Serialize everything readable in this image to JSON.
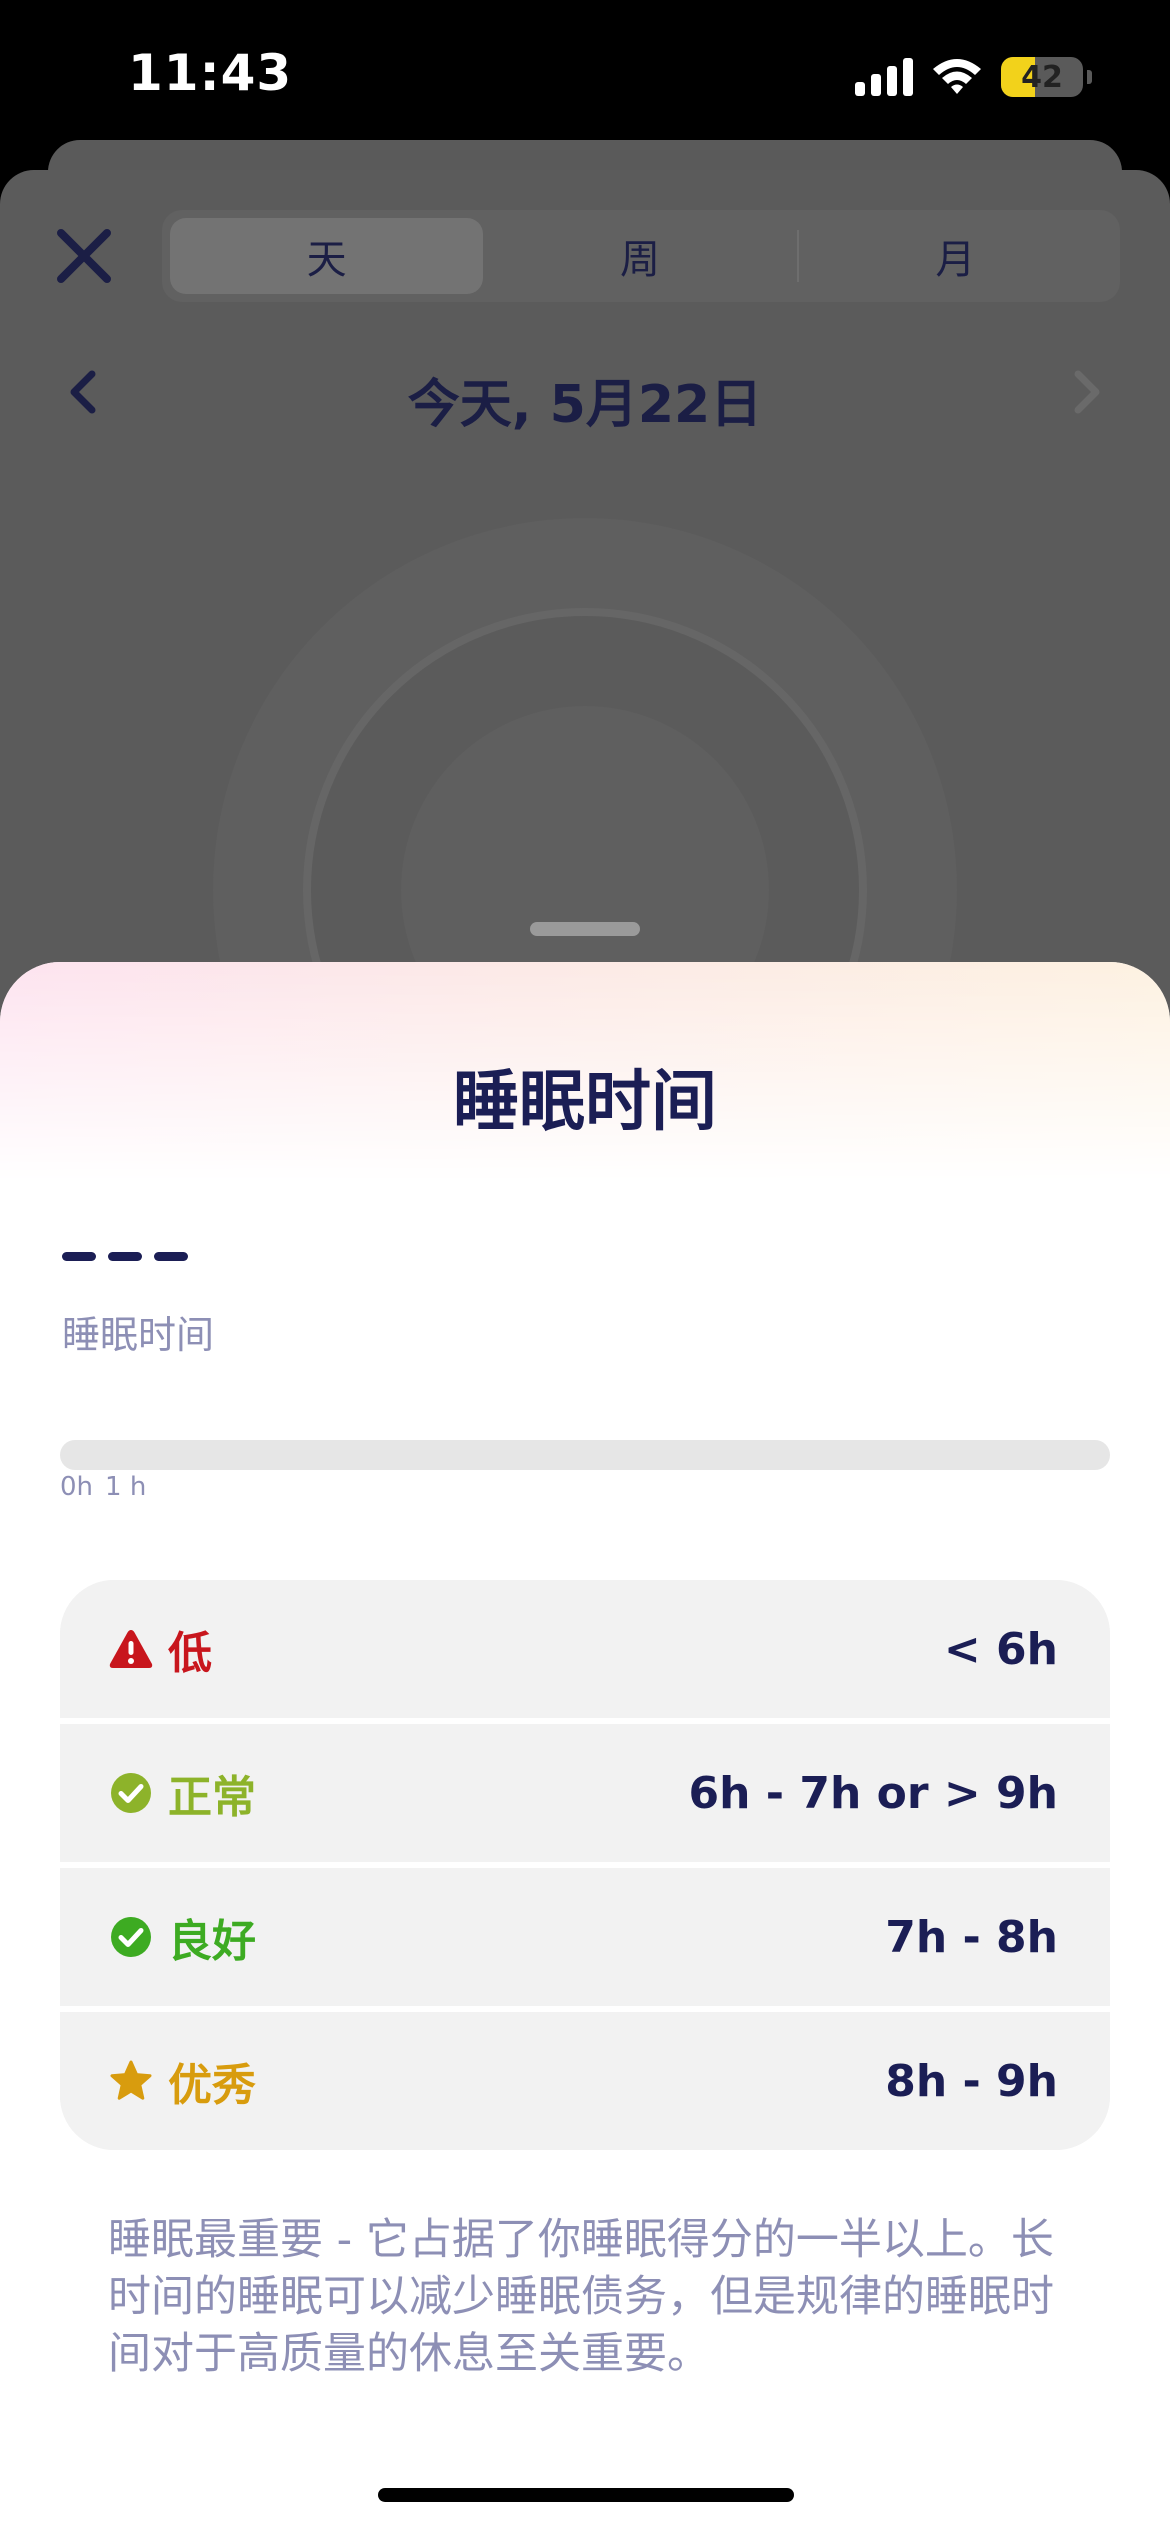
{
  "status_bar": {
    "time": "11:43",
    "battery": "42",
    "battery_level": 0.42
  },
  "segments": [
    {
      "label": "天",
      "active": true
    },
    {
      "label": "周",
      "active": false
    },
    {
      "label": "月",
      "active": false
    }
  ],
  "date_nav": {
    "title": "今天, 5月22日"
  },
  "sheet": {
    "title": "睡眠时间",
    "value_label": "睡眠时间",
    "progress": 0,
    "ticks": [
      "0h",
      "1 h"
    ]
  },
  "ranges": [
    {
      "label": "低",
      "value": "< 6h",
      "color": "#c8161d",
      "icon": "warning-icon"
    },
    {
      "label": "正常",
      "value": "6h - 7h or > 9h",
      "color": "#8db32a",
      "icon": "check-circle-icon"
    },
    {
      "label": "良好",
      "value": "7h - 8h",
      "color": "#3dab22",
      "icon": "check-circle-icon"
    },
    {
      "label": "优秀",
      "value": "8h - 9h",
      "color": "#d89c0e",
      "icon": "star-icon"
    }
  ],
  "description": "睡眠最重要 - 它占据了你睡眠得分的一半以上。长时间的睡眠可以减少睡眠债务，但是规律的睡眠时间对于高质量的休息至关重要。"
}
